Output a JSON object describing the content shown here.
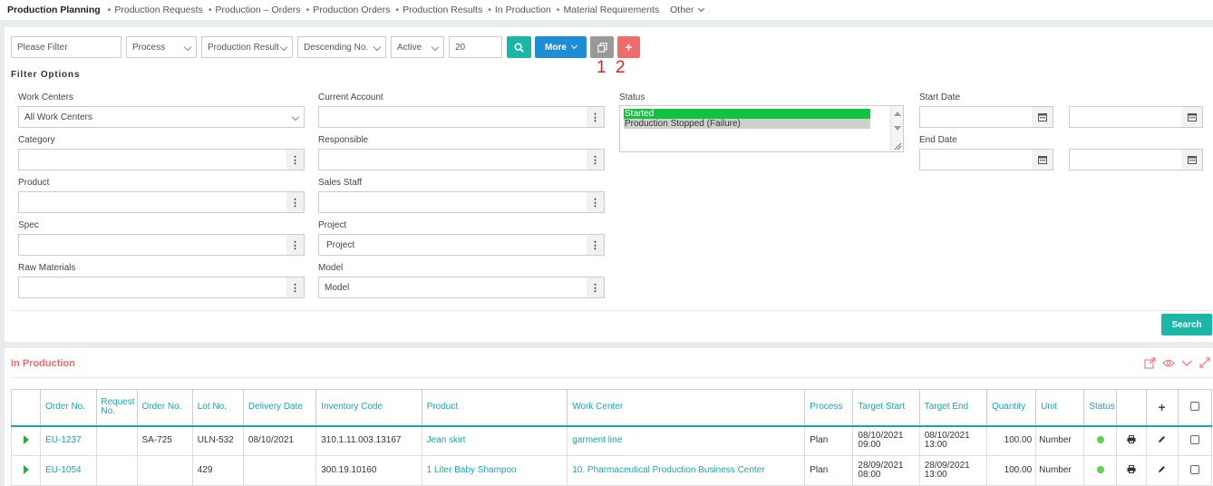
{
  "nav": {
    "items": [
      "Production Planning",
      "Production Requests",
      "Production – Orders",
      "Production Orders",
      "Production Results",
      "In Production",
      "Material Requirements"
    ],
    "other": "Other"
  },
  "toolbar": {
    "filter_placeholder": "Please Filter",
    "process": "Process",
    "production_result": "Production Result",
    "sort": "Descending No.",
    "active": "Active",
    "page_size": "20",
    "more": "More",
    "annot_1": "1",
    "annot_2": "2"
  },
  "filter": {
    "title": "Filter Options",
    "work_centers_label": "Work Centers",
    "work_centers_value": "All Work Centers",
    "category_label": "Category",
    "product_label": "Product",
    "spec_label": "Spec",
    "raw_materials_label": "Raw Materials",
    "current_account_label": "Current Account",
    "responsible_label": "Responsible",
    "sales_staff_label": "Sales Staff",
    "project_label": "Project",
    "project_value": "Project",
    "model_label": "Model",
    "model_value": "Model",
    "status_label": "Status",
    "status_options": [
      "Started",
      "Production Stopped (Failure)"
    ],
    "start_date_label": "Start Date",
    "end_date_label": "End Date",
    "search": "Search"
  },
  "production": {
    "title": "In Production",
    "columns": [
      "Order No.",
      "Request No.",
      "Order No.",
      "Lot No.",
      "Delivery Date",
      "Inventory Code",
      "Product",
      "Work Center",
      "Process",
      "Target Start",
      "Target End",
      "Quantity",
      "Unit",
      "Status"
    ],
    "rows": [
      {
        "order_no": "EU-1237",
        "request_no": "",
        "order_no2": "SA-725",
        "lot_no": "ULN-532",
        "delivery_date": "08/10/2021",
        "inventory_code": "310.1.11.003.13167",
        "product": "Jean skirt",
        "work_center": "garment line",
        "process": "Plan",
        "target_start_date": "08/10/2021",
        "target_start_time": "09:00",
        "target_end_date": "08/10/2021",
        "target_end_time": "13:00",
        "quantity": "100.00",
        "unit": "Number"
      },
      {
        "order_no": "EU-1054",
        "request_no": "",
        "order_no2": "",
        "lot_no": "429",
        "delivery_date": "",
        "inventory_code": "300.19.10160",
        "product": "1 Liter Baby Shampoo",
        "work_center": "10. Pharmaceutical Production Business Center",
        "process": "Plan",
        "target_start_date": "28/09/2021",
        "target_start_time": "08:00",
        "target_end_date": "28/09/2021",
        "target_end_time": "13:00",
        "quantity": "100.00",
        "unit": "Number"
      }
    ]
  },
  "colors": {
    "teal": "#1ab7a7",
    "blue": "#1f8dd6",
    "red": "#f06b6b",
    "status_selected": "#12c23e"
  }
}
